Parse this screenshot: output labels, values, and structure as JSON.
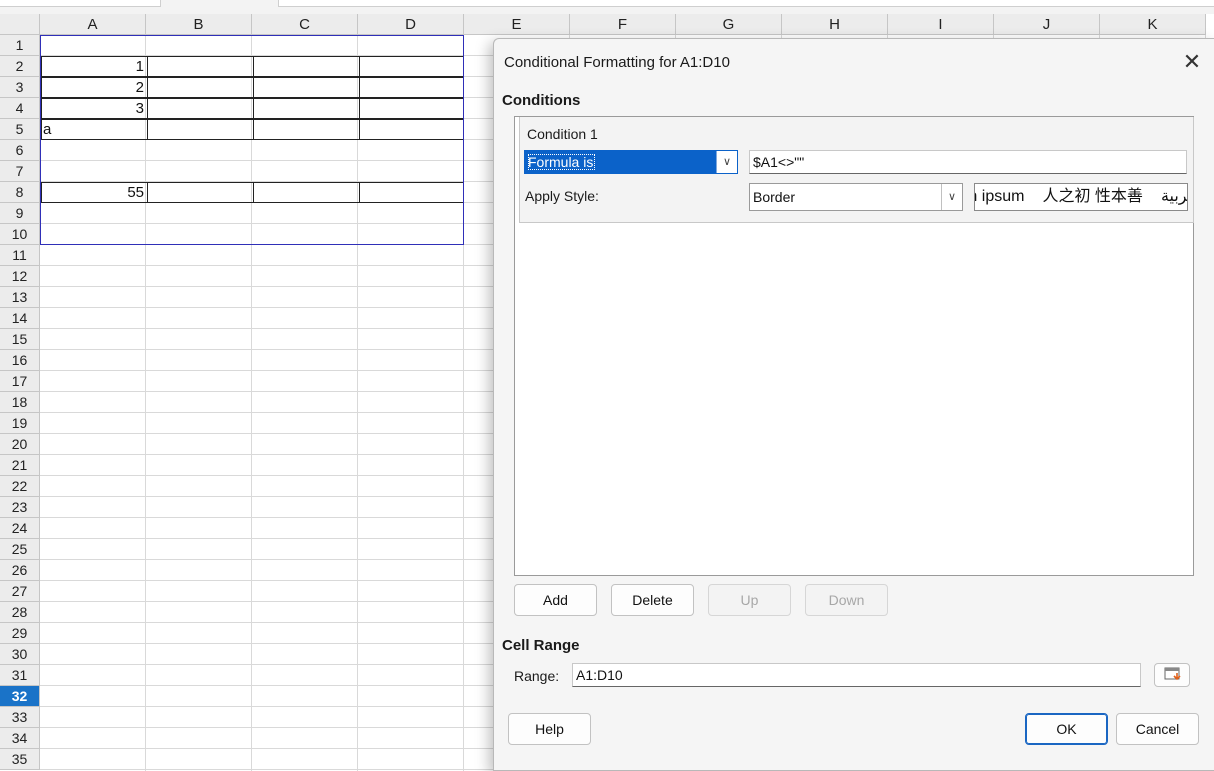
{
  "sheet": {
    "columns": [
      "A",
      "B",
      "C",
      "D",
      "E",
      "F",
      "G",
      "H",
      "I",
      "J",
      "K"
    ],
    "rows": [
      "1",
      "2",
      "3",
      "4",
      "5",
      "6",
      "7",
      "8",
      "9",
      "10",
      "11",
      "12",
      "13",
      "14",
      "15",
      "16",
      "17",
      "18",
      "19",
      "20",
      "21",
      "22",
      "23",
      "24",
      "25",
      "26",
      "27",
      "28",
      "29",
      "30",
      "31",
      "32",
      "33",
      "34",
      "35"
    ],
    "active_row": "32",
    "cells": {
      "a2": "1",
      "a3": "2",
      "a4": "3",
      "a5": "a",
      "a8": "55"
    }
  },
  "dialog": {
    "title": "Conditional Formatting for A1:D10",
    "conditions_heading": "Conditions",
    "condition_label": "Condition 1",
    "condition_type": "Formula is",
    "formula": "$A1<>\"\"",
    "apply_style_label": "Apply Style:",
    "style_value": "Border",
    "preview_texts": [
      "Lorem ipsum",
      "人之初 性本善",
      "العربية"
    ],
    "buttons": {
      "add": "Add",
      "delete": "Delete",
      "up": "Up",
      "down": "Down",
      "help": "Help",
      "ok": "OK",
      "cancel": "Cancel"
    },
    "cell_range_heading": "Cell Range",
    "range_label": "Range:",
    "range_value": "A1:D10"
  },
  "colors": {
    "selection_border": "#2f2fb8",
    "active_row_header": "#1a73c8",
    "combo_highlight": "#0b62c9"
  }
}
